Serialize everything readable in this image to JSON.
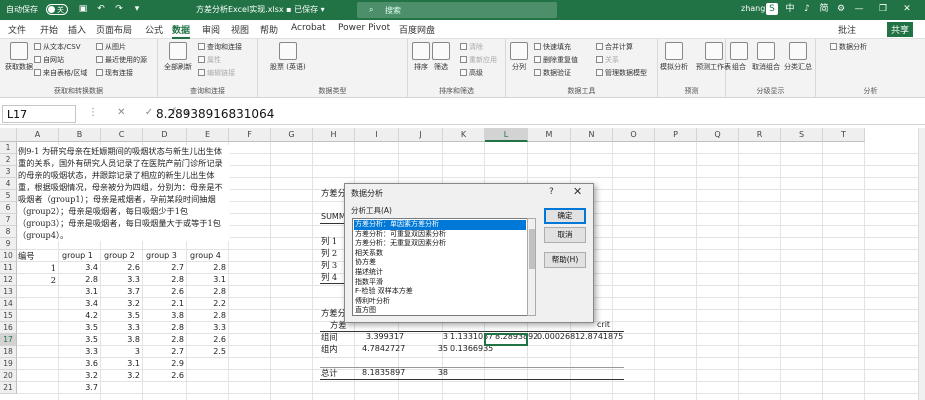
{
  "title_bar": {
    "autosave_label": "自动保存",
    "autosave_state": "关",
    "title": "方差分析Excel实现.xlsx  ▪  已保存 ▾",
    "search_placeholder": "搜索",
    "user": "zhang",
    "ime_labels": [
      "中",
      "♪",
      "简",
      "⚙"
    ]
  },
  "tabs": [
    "文件",
    "开始",
    "插入",
    "页面布局",
    "公式",
    "数据",
    "审阅",
    "视图",
    "帮助",
    "Acrobat",
    "Power Pivot",
    "百度网盘"
  ],
  "tabs_right": [
    "批注",
    "共享"
  ],
  "ribbon": {
    "groups": [
      {
        "label": "获取和转换数据",
        "items": [
          "获取数据",
          "从文本/CSV",
          "自网站",
          "来自表格/区域",
          "最近使用的源",
          "现有连接",
          "从图片"
        ]
      },
      {
        "label": "查询和连接",
        "items": [
          "全部刷新",
          "查询和连接",
          "属性",
          "编辑链接"
        ]
      },
      {
        "label": "数据类型",
        "items": [
          "股票 (英语)"
        ]
      },
      {
        "label": "排序和筛选",
        "items": [
          "排序",
          "筛选",
          "清除",
          "重新应用",
          "高级"
        ]
      },
      {
        "label": "数据工具",
        "items": [
          "分列",
          "快速填充",
          "删除重复值",
          "数据验证",
          "合并计算",
          "关系",
          "管理数据模型"
        ]
      },
      {
        "label": "预测",
        "items": [
          "模拟分析",
          "预测工作表"
        ]
      },
      {
        "label": "分级显示",
        "items": [
          "组合",
          "取消组合",
          "分类汇总"
        ]
      },
      {
        "label": "分析",
        "items": [
          "数据分析"
        ]
      }
    ]
  },
  "formula_bar": {
    "name_box": "L17",
    "icons": "⋮ ✕ ✓ fx",
    "formula": "8.28938916831064"
  },
  "columns": [
    "A",
    "B",
    "C",
    "D",
    "E",
    "F",
    "G",
    "H",
    "I",
    "J",
    "K",
    "L",
    "M",
    "N",
    "O",
    "P",
    "Q",
    "R",
    "S",
    "T"
  ],
  "rows": [
    "1",
    "2",
    "3",
    "4",
    "5",
    "6",
    "7",
    "8",
    "9",
    "10",
    "11",
    "12",
    "13",
    "14",
    "15",
    "16",
    "17",
    "18",
    "19",
    "20",
    "21"
  ],
  "selected_cell": {
    "column": "L",
    "row": "17"
  },
  "example_text": "例9-1 为研究母亲在妊娠期间的吸烟状态与新生儿出生体重的关系，国外有研究人员记录了在医院产前门诊所记录的母亲的吸烟状态，并跟踪记录了相应的新生儿出生体重，根据吸烟情况，母亲被分为四组，分别为：母亲是不吸烟者（group1）；母亲是戒烟者，孕前某段时间抽烟（group2）；母亲是吸烟者，每日吸烟少于1包（group3）；母亲是吸烟者，每日吸烟量大于或等于1包（group4）。",
  "table_header": [
    "编号",
    "group 1",
    "group 2",
    "group 3",
    "group 4"
  ],
  "table_rows": [
    [
      "1",
      "3.4",
      "2.6",
      "2.7",
      "2.8"
    ],
    [
      "2",
      "2.8",
      "3.3",
      "2.8",
      "3.1"
    ],
    [
      "",
      "3.1",
      "3.7",
      "2.6",
      "2.8"
    ],
    [
      "",
      "3.4",
      "3.2",
      "2.1",
      "2.2"
    ],
    [
      "",
      "4.2",
      "3.5",
      "3.8",
      "2.8"
    ],
    [
      "",
      "3.5",
      "3.3",
      "2.8",
      "3.3"
    ],
    [
      "",
      "3.5",
      "3.8",
      "2.8",
      "2.6"
    ],
    [
      "",
      "3.3",
      "3",
      "2.7",
      "2.5"
    ],
    [
      "",
      "3.6",
      "3.1",
      "2.9",
      ""
    ],
    [
      "",
      "3.2",
      "3.2",
      "2.6",
      ""
    ],
    [
      "",
      "3.7",
      "",
      "",
      ""
    ]
  ],
  "anova": {
    "title1": "方差分",
    "summary": "SUMMA",
    "group_rows": [
      "列 1",
      "列 2",
      "列 3",
      "列 4"
    ],
    "title2": "方差分",
    "header2": "方差",
    "crit_label": "crit",
    "between": {
      "label": "组间",
      "ss": "3.399317",
      "df": "3",
      "ms": "1.1331057",
      "f": "8.2893892",
      "p": "0.0002681",
      "crit": "2.8741875"
    },
    "within": {
      "label": "组内",
      "ss": "4.7842727",
      "df": "35",
      "ms": "0.1366935"
    },
    "total": {
      "label": "总计",
      "ss": "8.1835897",
      "df": "38"
    }
  },
  "dialog": {
    "title": "数据分析",
    "help": "?",
    "close": "✕",
    "list_label": "分析工具(A)",
    "items": [
      "方差分析：单因素方差分析",
      "方差分析：可重复双因素分析",
      "方差分析：无重复双因素分析",
      "相关系数",
      "协方差",
      "描述统计",
      "指数平滑",
      "F-检验 双样本方差",
      "傅利叶分析",
      "直方图"
    ],
    "selected_index": 0,
    "ok": "确定",
    "cancel": "取消",
    "help_button": "帮助(H)"
  }
}
